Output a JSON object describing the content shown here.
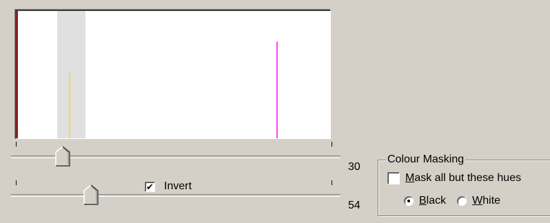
{
  "histogram": {
    "selected_range": {
      "start": 0.13,
      "end": 0.22
    },
    "lines": [
      {
        "name": "red-line",
        "position": 0.0,
        "height": 1.0,
        "color": "#d00000"
      },
      {
        "name": "yellow-line",
        "position": 0.17,
        "height": 0.52,
        "color": "#f0e040"
      },
      {
        "name": "magenta-line",
        "position": 0.83,
        "height": 0.76,
        "color": "#ff40ff"
      }
    ],
    "band_color": "#e0e0e0"
  },
  "slider_top": {
    "value": "30",
    "level": 0.13
  },
  "slider_bottom": {
    "value": "54",
    "level": 0.22
  },
  "invert": {
    "label": "Invert",
    "checked": true,
    "check_glyph": "✔"
  },
  "colour_masking": {
    "title": "Colour Masking",
    "mask_checkbox": {
      "mnemonic": "M",
      "label_rest": "ask all but these hues",
      "checked": false
    },
    "radio_black": {
      "mnemonic": "B",
      "label_rest": "lack",
      "selected": true
    },
    "radio_white": {
      "mnemonic": "W",
      "label_rest": "hite",
      "selected": false
    }
  }
}
